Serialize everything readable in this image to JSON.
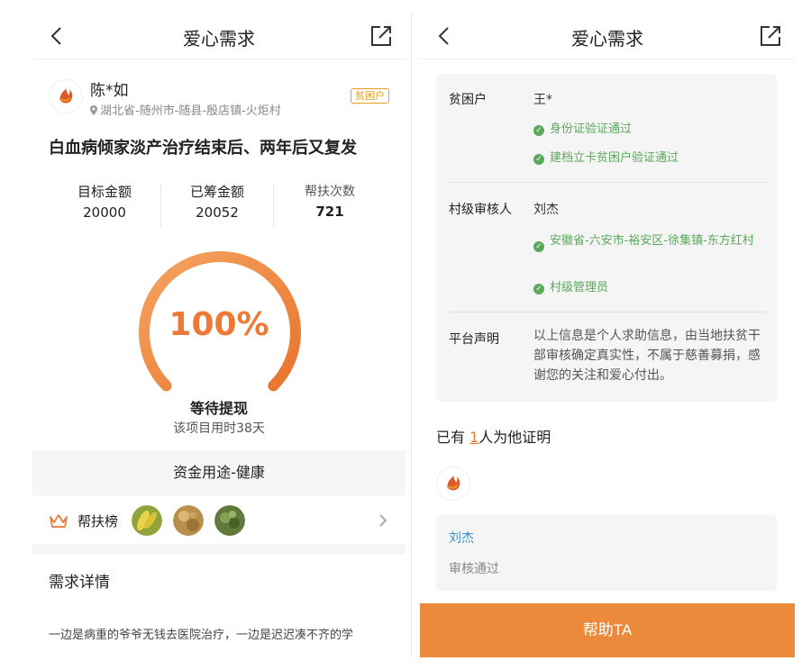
{
  "left": {
    "nav": {
      "title": "爱心需求"
    },
    "user": {
      "name": "陈*如",
      "location": "湖北省-随州市-随县-殷店镇-火炬村",
      "badge": "贫困户"
    },
    "headline": "白血病倾家淡产治疗结束后、两年后又复发",
    "stats": [
      {
        "label": "目标金额",
        "value": "20000"
      },
      {
        "label": "已筹金额",
        "value": "20052"
      },
      {
        "label": "帮扶次数",
        "value": "721"
      }
    ],
    "progress": {
      "percent_text": "100%",
      "fraction": 1.0
    },
    "status": "等待提现",
    "status_sub": "该项目用时38天",
    "fund_use": "资金用途-健康",
    "helpers": {
      "label": "帮扶榜"
    },
    "detail": {
      "title": "需求详情",
      "text": "一边是病重的爷爷无钱去医院治疗，一边是迟迟凑不齐的学"
    }
  },
  "right": {
    "nav": {
      "title": "爱心需求"
    },
    "poor": {
      "label": "贫困户",
      "name": "王*",
      "checks": [
        "身份证验证通过",
        "建档立卡贫困户验证通过"
      ]
    },
    "village": {
      "label": "村级审核人",
      "name": "刘杰",
      "checks": [
        "安徽省-六安市-裕安区-徐集镇-东方红村",
        "村级管理员"
      ]
    },
    "declaration": {
      "label": "平台声明",
      "text": "以上信息是个人求助信息，由当地扶贫干部审核确定真实性，不属于慈善募捐，感谢您的关注和爱心付出。"
    },
    "certify": {
      "prefix": "已有 ",
      "count": "1",
      "suffix": "人为他证明"
    },
    "reviewer": {
      "name": "刘杰",
      "status": "审核通过"
    },
    "help_button": "帮助TA"
  },
  "colors": {
    "accent": "#ec7a34",
    "verified": "#5aa85a",
    "link": "#3a8fd6",
    "badge": "#e8a020"
  }
}
